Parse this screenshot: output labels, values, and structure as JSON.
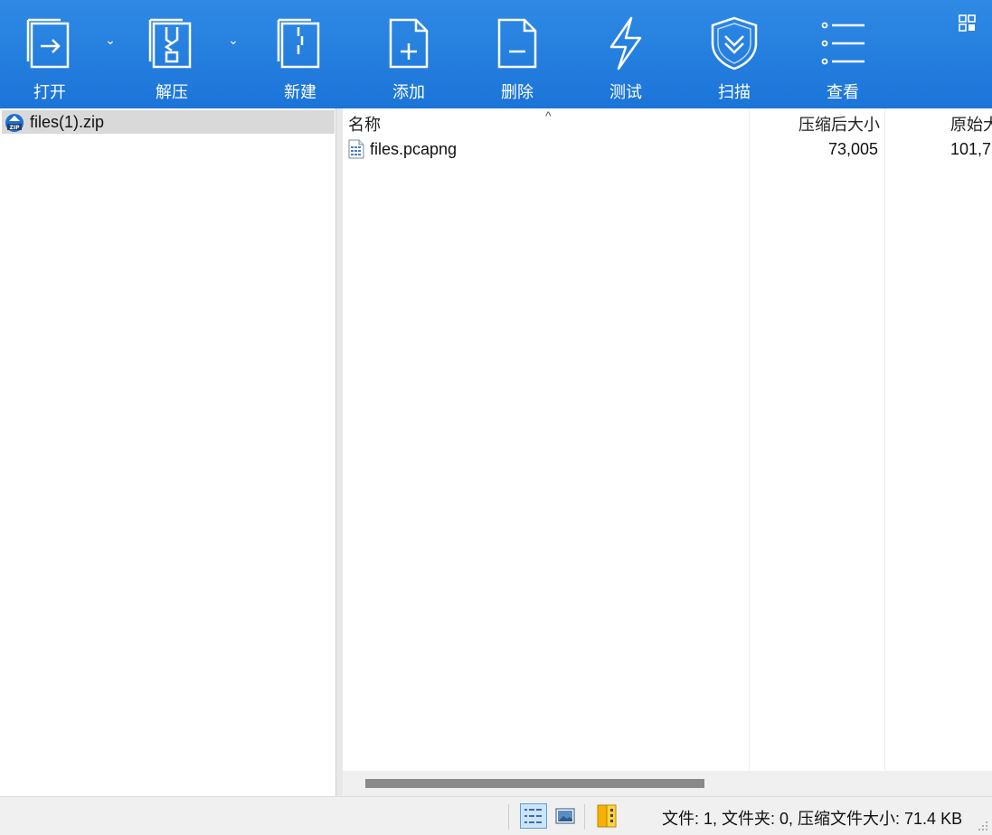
{
  "toolbar": {
    "open": "打开",
    "extract": "解压",
    "new": "新建",
    "add": "添加",
    "delete": "删除",
    "test": "测试",
    "scan": "扫描",
    "view": "查看",
    "accent": "#1f7ad9"
  },
  "tree": {
    "items": [
      {
        "label": "files(1).zip",
        "icon": "zip-archive-icon"
      }
    ]
  },
  "list": {
    "columns": {
      "name": "名称",
      "compressed": "压缩后大小",
      "original": "原始大"
    },
    "rows": [
      {
        "name": "files.pcapng",
        "compressed": "73,005",
        "original": "101,7"
      }
    ]
  },
  "status": {
    "text": "文件: 1, 文件夹: 0, 压缩文件大小: 71.4 KB"
  }
}
